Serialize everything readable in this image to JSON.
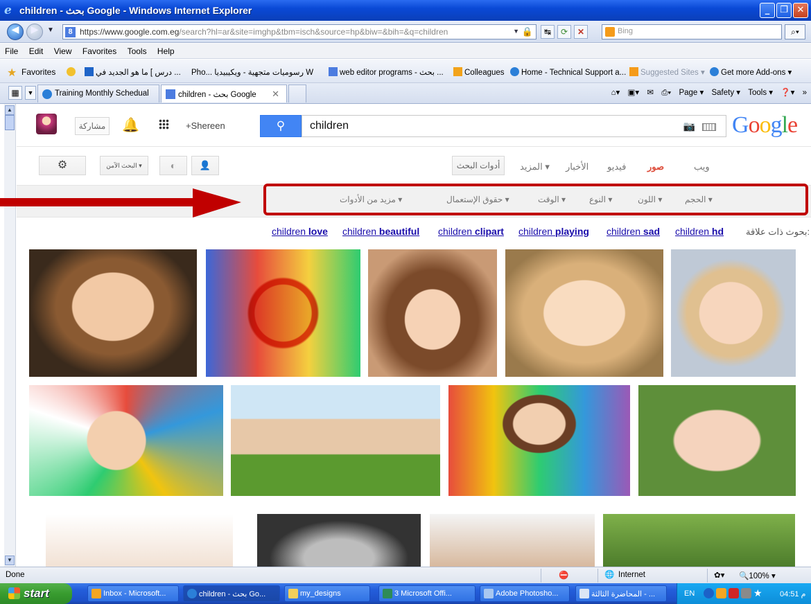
{
  "window": {
    "title": "children - بحث Google - Windows Internet Explorer",
    "buttons": [
      "_",
      "❐",
      "✕"
    ]
  },
  "address": {
    "url_host": "https://www.google.com.eg",
    "url_path": "/search?hl=ar&site=imghp&tbm=isch&source=hp&biw=&bih=&q=children",
    "search_placeholder": "Bing"
  },
  "menu": [
    "File",
    "Edit",
    "View",
    "Favorites",
    "Tools",
    "Help"
  ],
  "favorites": {
    "label": "Favorites",
    "items": [
      "درس ] ما هو الجديد في ...",
      "Pho... رسوميات متجهية - ويكيبيديا  W",
      "web editor programs - بحث ...",
      "Colleagues",
      "Home - Technical Support a...",
      "Suggested Sites ▾",
      "Get more Add-ons ▾"
    ]
  },
  "tabs": [
    {
      "label": "Training Monthly Schedual"
    },
    {
      "label": "children - بحث Google"
    }
  ],
  "commandbar": [
    "Page ▾",
    "Safety ▾",
    "Tools ▾"
  ],
  "google": {
    "share": "مشاركة",
    "user": "+Shereen",
    "query": "children",
    "logo": "Google",
    "safe_search": "البحث الآمن ▾",
    "search_tools": "أدوات البحث",
    "nav": [
      {
        "label": "ويب",
        "active": false
      },
      {
        "label": "صور",
        "active": true
      },
      {
        "label": "فيديو",
        "active": false
      },
      {
        "label": "الأخبار",
        "active": false
      },
      {
        "label": "المزيد ▾",
        "active": false
      }
    ],
    "tool_filters": [
      "الحجم ▾",
      "اللون ▾",
      "النوع ▾",
      "الوقت ▾",
      "حقوق الإستعمال ▾",
      "مزيد من الأدوات ▾"
    ],
    "related_label": "بحوث ذات علاقة:",
    "related": [
      {
        "base": "children",
        "bold": "hd"
      },
      {
        "base": "children",
        "bold": "sad"
      },
      {
        "base": "children",
        "bold": "playing"
      },
      {
        "base": "children",
        "bold": "clipart"
      },
      {
        "base": "children",
        "bold": "beautiful"
      },
      {
        "base": "children",
        "bold": "love"
      }
    ]
  },
  "status": {
    "text": "Done",
    "zone": "Internet",
    "zoom": "100%"
  },
  "taskbar": {
    "start": "start",
    "items": [
      "Inbox - Microsoft...",
      "children - بحث Go...",
      "my_designs",
      "3 Microsoft Offi...",
      "Adobe Photosho...",
      "المحاضرة الثالثة - ..."
    ],
    "lang": "EN",
    "clock": "04:51 م"
  }
}
